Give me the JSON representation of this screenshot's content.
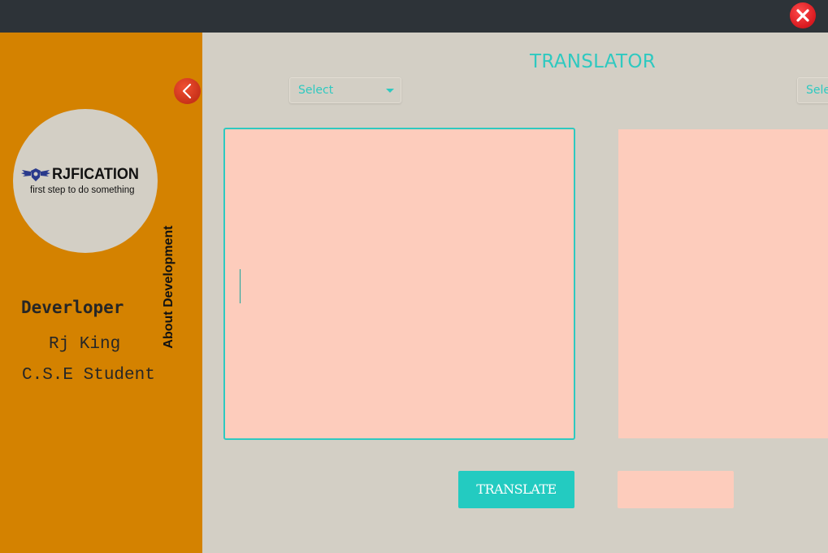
{
  "window": {
    "close_icon": "close-x-icon",
    "titlebar_color": "#2d3338"
  },
  "sidebar": {
    "color": "#d48200",
    "logo": {
      "name": "RJFICATION",
      "tagline": "first step to do something"
    },
    "developer_heading": "Deverloper",
    "developer_name": "Rj King",
    "developer_role": "C.S.E Student",
    "about_label": "About Development",
    "back_icon": "chevron-left-icon"
  },
  "main": {
    "title": "TRANSLATOR",
    "accent_color": "#2ec9c0",
    "source_language": {
      "value": "Select"
    },
    "target_language": {
      "value": "Sele"
    },
    "input_text": "",
    "output_text": "",
    "translate_label": "TRANSLATE",
    "second_button_label": ""
  }
}
